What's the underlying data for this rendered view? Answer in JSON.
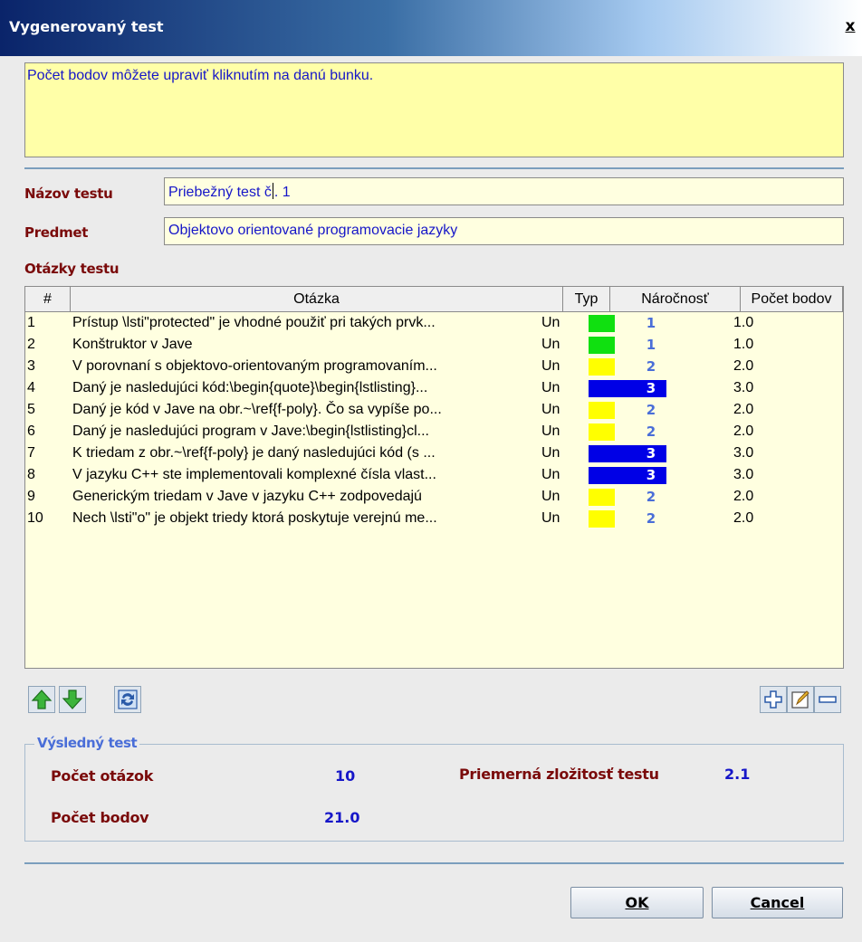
{
  "window": {
    "title": "Vygenerovaný test",
    "close_label": "x"
  },
  "info_text": "Počet bodov môžete upraviť kliknutím na danú bunku.",
  "form": {
    "name_label": "Názov testu",
    "name_value_before": "Priebežný test č",
    "name_value_after": ". 1",
    "subject_label": "Predmet",
    "subject_value": "Objektovo orientované programovacie jazyky",
    "questions_label": "Otázky testu"
  },
  "table": {
    "headers": {
      "num": "#",
      "question": "Otázka",
      "type": "Typ",
      "difficulty": "Náročnosť",
      "points": "Počet bodov"
    },
    "rows": [
      {
        "num": "1",
        "question": "Prístup \\lsti\"protected\" je vhodné použiť pri takých prvk...",
        "type": "Un",
        "difficulty": "1",
        "points": "1.0"
      },
      {
        "num": "2",
        "question": "Konštruktor v Jave",
        "type": "Un",
        "difficulty": "1",
        "points": "1.0"
      },
      {
        "num": "3",
        "question": "V porovnaní s objektovo-orientovaným programovaním...",
        "type": "Un",
        "difficulty": "2",
        "points": "2.0"
      },
      {
        "num": "4",
        "question": "Daný je nasledujúci kód:\\begin{quote}\\begin{lstlisting}...",
        "type": "Un",
        "difficulty": "3",
        "points": "3.0"
      },
      {
        "num": "5",
        "question": "Daný je kód v Jave na obr.~\\ref{f-poly}. Čo sa vypíše po...",
        "type": "Un",
        "difficulty": "2",
        "points": "2.0"
      },
      {
        "num": "6",
        "question": "Daný je nasledujúci program v Jave:\\begin{lstlisting}cl...",
        "type": "Un",
        "difficulty": "2",
        "points": "2.0"
      },
      {
        "num": "7",
        "question": "K triedam z obr.~\\ref{f-poly} je daný nasledujúci kód (s ...",
        "type": "Un",
        "difficulty": "3",
        "points": "3.0"
      },
      {
        "num": "8",
        "question": "V jazyku C++ ste implementovali komplexné čísla vlast...",
        "type": "Un",
        "difficulty": "3",
        "points": "3.0"
      },
      {
        "num": "9",
        "question": "Generickým triedam v Jave v jazyku C++ zodpovedajú",
        "type": "Un",
        "difficulty": "2",
        "points": "2.0"
      },
      {
        "num": "10",
        "question": "Nech \\lsti\"o\" je objekt triedy ktorá poskytuje verejnú me...",
        "type": "Un",
        "difficulty": "2",
        "points": "2.0"
      }
    ]
  },
  "difficulty_colors": {
    "1": "#10e010",
    "2": "#ffff00",
    "3": "#0000e6"
  },
  "toolbar_icons": [
    "move-up-icon",
    "move-down-icon",
    "refresh-icon",
    "add-icon",
    "edit-icon",
    "remove-icon"
  ],
  "summary": {
    "legend": "Výsledný test",
    "question_count_label": "Počet otázok",
    "question_count_value": "10",
    "points_label": "Počet bodov",
    "points_value": "21.0",
    "avg_difficulty_label": "Priemerná zložitosť testu",
    "avg_difficulty_value": "2.1"
  },
  "buttons": {
    "ok": "OK",
    "cancel": "Cancel"
  }
}
